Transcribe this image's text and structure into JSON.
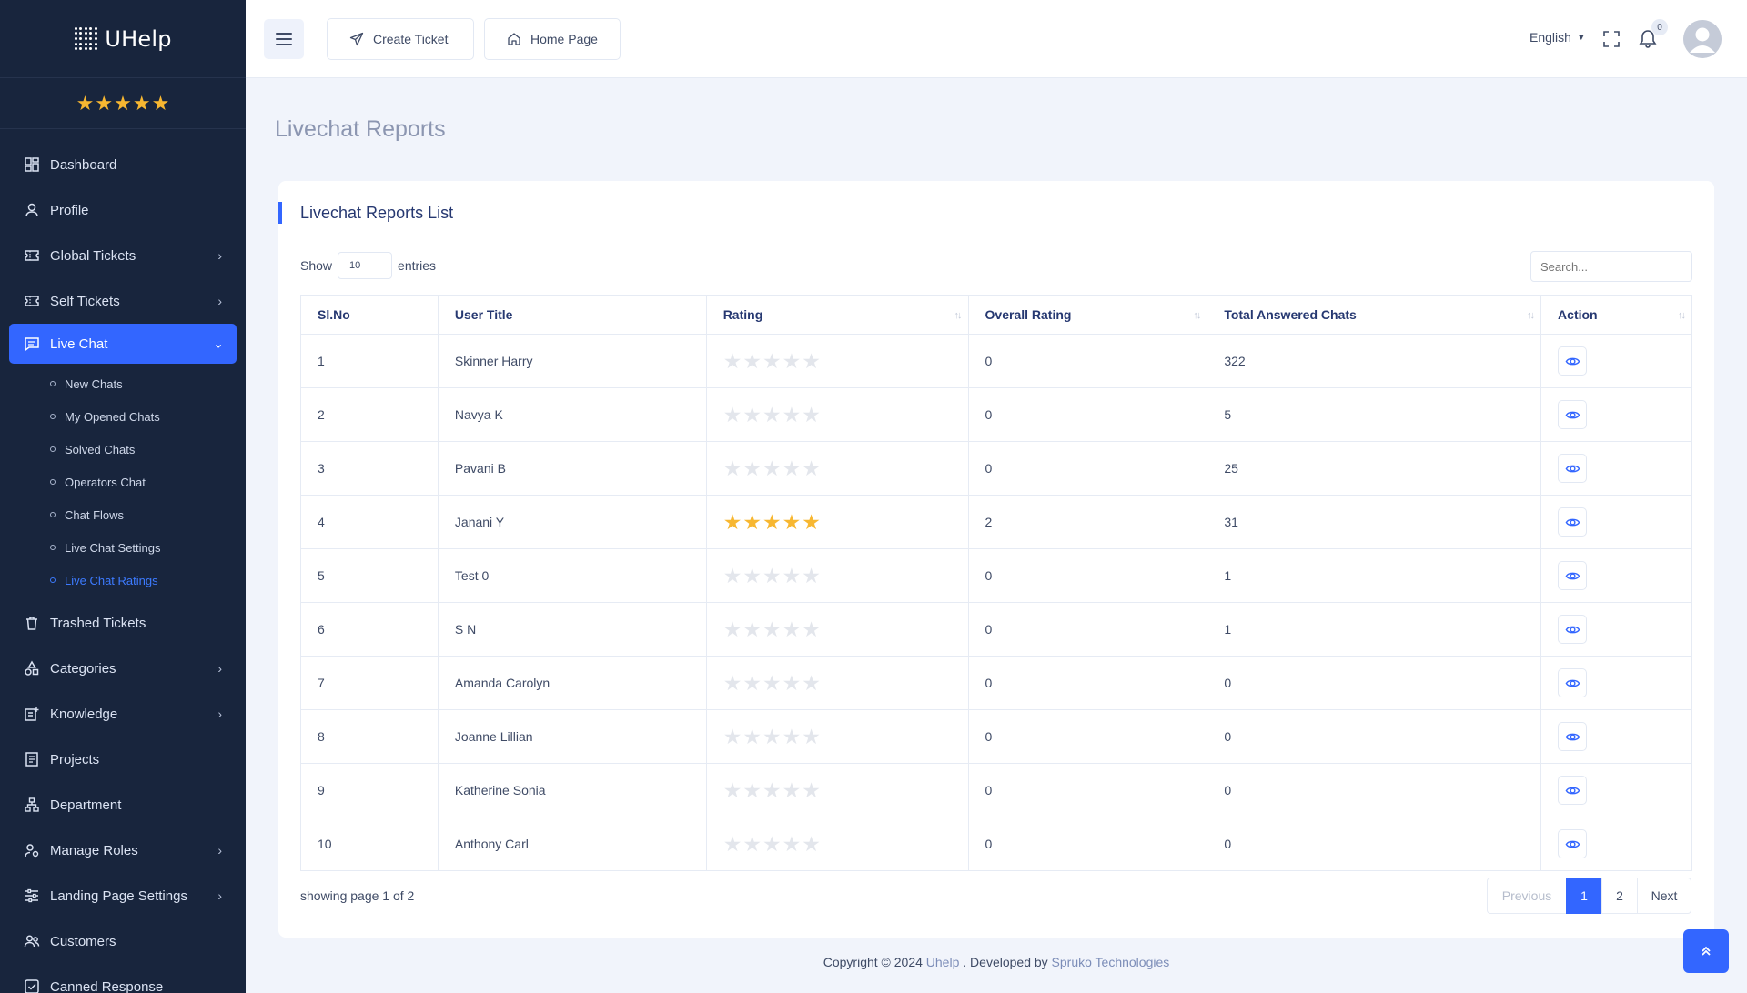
{
  "app": {
    "name": "UHelp"
  },
  "sidebar": {
    "rating_stars": 5,
    "items": [
      {
        "label": "Dashboard",
        "icon": "dashboard-icon",
        "chevron": false
      },
      {
        "label": "Profile",
        "icon": "user-icon",
        "chevron": false
      },
      {
        "label": "Global Tickets",
        "icon": "ticket-icon",
        "chevron": true
      },
      {
        "label": "Self Tickets",
        "icon": "ticket-icon",
        "chevron": true
      },
      {
        "label": "Live Chat",
        "icon": "chat-icon",
        "chevron": true,
        "active": true
      },
      {
        "label": "Trashed Tickets",
        "icon": "trash-icon",
        "chevron": false
      },
      {
        "label": "Categories",
        "icon": "shapes-icon",
        "chevron": true
      },
      {
        "label": "Knowledge",
        "icon": "knowledge-icon",
        "chevron": true
      },
      {
        "label": "Projects",
        "icon": "projects-icon",
        "chevron": false
      },
      {
        "label": "Department",
        "icon": "department-icon",
        "chevron": false
      },
      {
        "label": "Manage Roles",
        "icon": "roles-icon",
        "chevron": true
      },
      {
        "label": "Landing Page Settings",
        "icon": "sliders-icon",
        "chevron": true
      },
      {
        "label": "Customers",
        "icon": "customers-icon",
        "chevron": false
      },
      {
        "label": "Canned Response",
        "icon": "canned-icon",
        "chevron": false
      }
    ],
    "live_chat_sub": [
      "New Chats",
      "My Opened Chats",
      "Solved Chats",
      "Operators Chat",
      "Chat Flows",
      "Live Chat Settings",
      "Live Chat Ratings"
    ]
  },
  "header": {
    "create_ticket": "Create Ticket",
    "home_page": "Home Page",
    "language": "English",
    "notification_count": "0"
  },
  "page": {
    "title": "Livechat Reports",
    "card_title": "Livechat Reports List",
    "show_label": "Show",
    "entries_value": "10",
    "entries_label": "entries",
    "search_placeholder": "Search..."
  },
  "table": {
    "columns": [
      "Sl.No",
      "User Title",
      "Rating",
      "Overall Rating",
      "Total Answered Chats",
      "Action"
    ],
    "rows": [
      {
        "sl": "1",
        "user": "Skinner Harry",
        "stars": 0,
        "overall": "0",
        "answered": "322"
      },
      {
        "sl": "2",
        "user": "Navya K",
        "stars": 0,
        "overall": "0",
        "answered": "5"
      },
      {
        "sl": "3",
        "user": "Pavani B",
        "stars": 0,
        "overall": "0",
        "answered": "25"
      },
      {
        "sl": "4",
        "user": "Janani Y",
        "stars": 5,
        "overall": "2",
        "answered": "31"
      },
      {
        "sl": "5",
        "user": "Test 0",
        "stars": 0,
        "overall": "0",
        "answered": "1"
      },
      {
        "sl": "6",
        "user": "S N",
        "stars": 0,
        "overall": "0",
        "answered": "1"
      },
      {
        "sl": "7",
        "user": "Amanda Carolyn",
        "stars": 0,
        "overall": "0",
        "answered": "0"
      },
      {
        "sl": "8",
        "user": "Joanne Lillian",
        "stars": 0,
        "overall": "0",
        "answered": "0"
      },
      {
        "sl": "9",
        "user": "Katherine Sonia",
        "stars": 0,
        "overall": "0",
        "answered": "0"
      },
      {
        "sl": "10",
        "user": "Anthony Carl",
        "stars": 0,
        "overall": "0",
        "answered": "0"
      }
    ]
  },
  "pagination": {
    "info": "showing page 1 of 2",
    "previous": "Previous",
    "pages": [
      "1",
      "2"
    ],
    "next": "Next"
  },
  "footer": {
    "prefix": "Copyright © 2024 ",
    "app_link": "Uhelp",
    "middle": " . Developed by ",
    "dev_link": "Spruko Technologies"
  },
  "colors": {
    "sidebar_bg": "#18253d",
    "accent": "#3366ff",
    "star": "#f7b731"
  }
}
